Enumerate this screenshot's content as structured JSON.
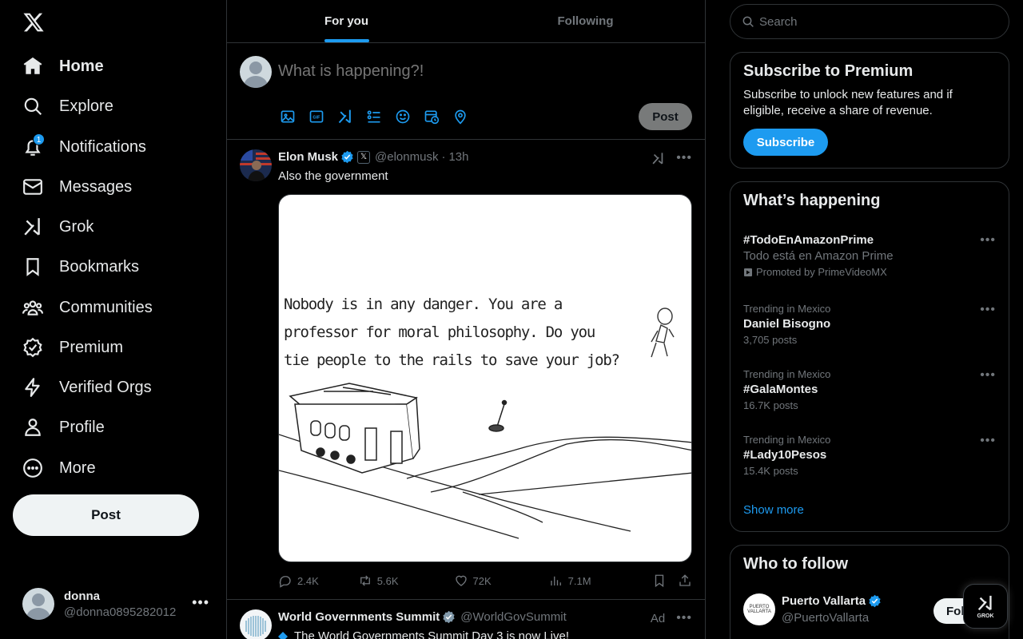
{
  "sidebar": {
    "logo": "x-logo-icon",
    "items": [
      {
        "label": "Home",
        "icon": "home-icon",
        "active": true
      },
      {
        "label": "Explore",
        "icon": "search-icon"
      },
      {
        "label": "Notifications",
        "icon": "bell-icon",
        "badge": "1"
      },
      {
        "label": "Messages",
        "icon": "envelope-icon"
      },
      {
        "label": "Grok",
        "icon": "grok-icon"
      },
      {
        "label": "Bookmarks",
        "icon": "bookmark-icon"
      },
      {
        "label": "Communities",
        "icon": "people-icon"
      },
      {
        "label": "Premium",
        "icon": "verified-badge-icon"
      },
      {
        "label": "Verified Orgs",
        "icon": "lightning-icon"
      },
      {
        "label": "Profile",
        "icon": "person-icon"
      },
      {
        "label": "More",
        "icon": "more-circle-icon"
      }
    ],
    "post_button": "Post",
    "account": {
      "name": "donna",
      "handle": "@donna0895282012"
    }
  },
  "main": {
    "tabs": [
      {
        "label": "For you",
        "active": true
      },
      {
        "label": "Following"
      }
    ],
    "composer": {
      "placeholder": "What is happening?!",
      "post_label": "Post"
    },
    "tweets": [
      {
        "name": "Elon Musk",
        "handle": "@elonmusk",
        "time": "13h",
        "text": "Also the government",
        "meme_text": "Nobody is in any danger. You are a professor for moral philosophy. Do you tie people to the rails to save your job?",
        "replies": "2.4K",
        "reposts": "5.6K",
        "likes": "72K",
        "views": "7.1M"
      },
      {
        "name": "World Governments Summit",
        "handle": "@WorldGovSummit",
        "ad_label": "Ad",
        "text": "The World Governments Summit Day 3 is now Live!"
      }
    ]
  },
  "right": {
    "search_placeholder": "Search",
    "premium": {
      "title": "Subscribe to Premium",
      "body": "Subscribe to unlock new features and if eligible, receive a share of revenue.",
      "button": "Subscribe"
    },
    "happening": {
      "title": "What’s happening",
      "promoted": {
        "name": "#TodoEnAmazonPrime",
        "subtitle": "Todo está en Amazon Prime",
        "promoted_by": "Promoted by PrimeVideoMX"
      },
      "trends": [
        {
          "context": "Trending in Mexico",
          "name": "Daniel Bisogno",
          "posts": "3,705 posts"
        },
        {
          "context": "Trending in Mexico",
          "name": "#GalaMontes",
          "posts": "16.7K posts"
        },
        {
          "context": "Trending in Mexico",
          "name": "#Lady10Pesos",
          "posts": "15.4K posts"
        }
      ],
      "show_more": "Show more"
    },
    "follow": {
      "title": "Who to follow",
      "name": "Puerto Vallarta",
      "handle": "@PuertoVallarta",
      "logo_text": "PUERTO VALLARTA",
      "button": "Follow"
    },
    "grok_fab": "GROK"
  },
  "colors": {
    "accent": "#1d9bf0",
    "background": "#000000",
    "border": "#2f3336",
    "muted": "#71767b",
    "text": "#e7e9ea"
  }
}
